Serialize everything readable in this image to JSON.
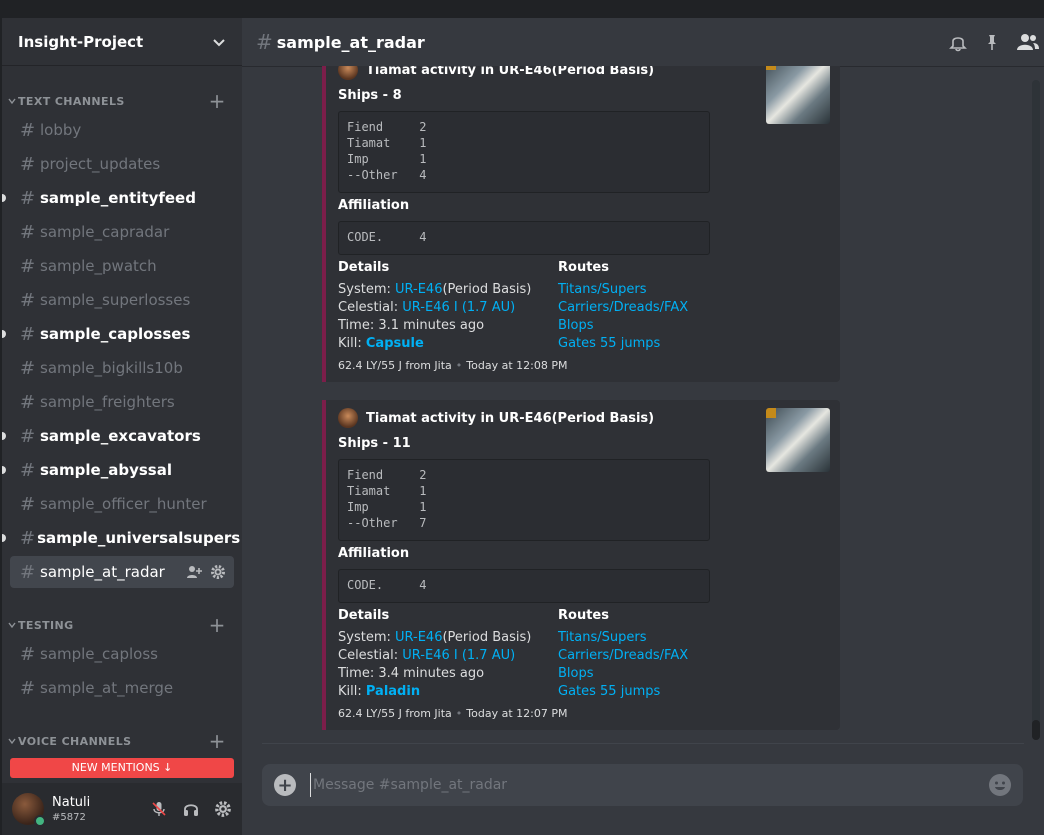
{
  "guild": {
    "name": "Insight-Project"
  },
  "categories": [
    {
      "label": "TEXT CHANNELS"
    },
    {
      "label": "TESTING"
    },
    {
      "label": "VOICE CHANNELS"
    }
  ],
  "channels": [
    {
      "name": "lobby"
    },
    {
      "name": "project_updates"
    },
    {
      "name": "sample_entityfeed"
    },
    {
      "name": "sample_capradar"
    },
    {
      "name": "sample_pwatch"
    },
    {
      "name": "sample_superlosses"
    },
    {
      "name": "sample_caplosses"
    },
    {
      "name": "sample_bigkills10b"
    },
    {
      "name": "sample_freighters"
    },
    {
      "name": "sample_excavators"
    },
    {
      "name": "sample_abyssal"
    },
    {
      "name": "sample_officer_hunter"
    },
    {
      "name": "sample_universalsupers"
    },
    {
      "name": "sample_at_radar"
    }
  ],
  "testing_channels": [
    {
      "name": "sample_caploss"
    },
    {
      "name": "sample_at_merge"
    }
  ],
  "new_mentions": "NEW MENTIONS",
  "user": {
    "name": "Natuli",
    "tag": "#5872"
  },
  "header": {
    "channel": "sample_at_radar"
  },
  "embeds": [
    {
      "author": "Tiamat activity in UR-E46(Period Basis)",
      "ships_title": "Ships - 8",
      "ships_block": "Fiend     2\nTiamat    1\nImp       1\n--Other   4",
      "affiliation_title": "Affiliation",
      "affiliation_block": "CODE.     4",
      "details_title": "Details",
      "routes_title": "Routes",
      "system_label": "System: ",
      "system_link": "UR-E46",
      "system_suffix": "(Period Basis)",
      "celestial_label": "Celestial: ",
      "celestial_link": "UR-E46 I (1.7 AU)",
      "time": "Time: 3.1 minutes ago",
      "kill_label": "Kill: ",
      "kill_link": "Capsule",
      "routes": [
        "Titans/Supers",
        "Carriers/Dreads/FAX",
        "Blops",
        "Gates 55 jumps"
      ],
      "footer_left": "62.4 LY/55 J from Jita",
      "footer_right": "Today at 12:08 PM"
    },
    {
      "author": "Tiamat activity in UR-E46(Period Basis)",
      "ships_title": "Ships - 11",
      "ships_block": "Fiend     2\nTiamat    1\nImp       1\n--Other   7",
      "affiliation_title": "Affiliation",
      "affiliation_block": "CODE.     4",
      "details_title": "Details",
      "routes_title": "Routes",
      "system_label": "System: ",
      "system_link": "UR-E46",
      "system_suffix": "(Period Basis)",
      "celestial_label": "Celestial: ",
      "celestial_link": "UR-E46 I (1.7 AU)",
      "time": "Time: 3.4 minutes ago",
      "kill_label": "Kill: ",
      "kill_link": "Paladin",
      "routes": [
        "Titans/Supers",
        "Carriers/Dreads/FAX",
        "Blops",
        "Gates 55 jumps"
      ],
      "footer_left": "62.4 LY/55 J from Jita",
      "footer_right": "Today at 12:07 PM"
    }
  ],
  "composer": {
    "placeholder": "Message #sample_at_radar"
  },
  "colors": {
    "embed_accent": "#7c1e4a",
    "link": "#00b0f4",
    "mentions": "#f04747",
    "online": "#43b581"
  },
  "icons": [
    "chevron-down-icon",
    "bell-icon",
    "pin-icon",
    "members-icon",
    "add-member-icon",
    "gear-icon",
    "mute-mic-icon",
    "headphones-icon",
    "plus-icon",
    "emoji-icon"
  ]
}
